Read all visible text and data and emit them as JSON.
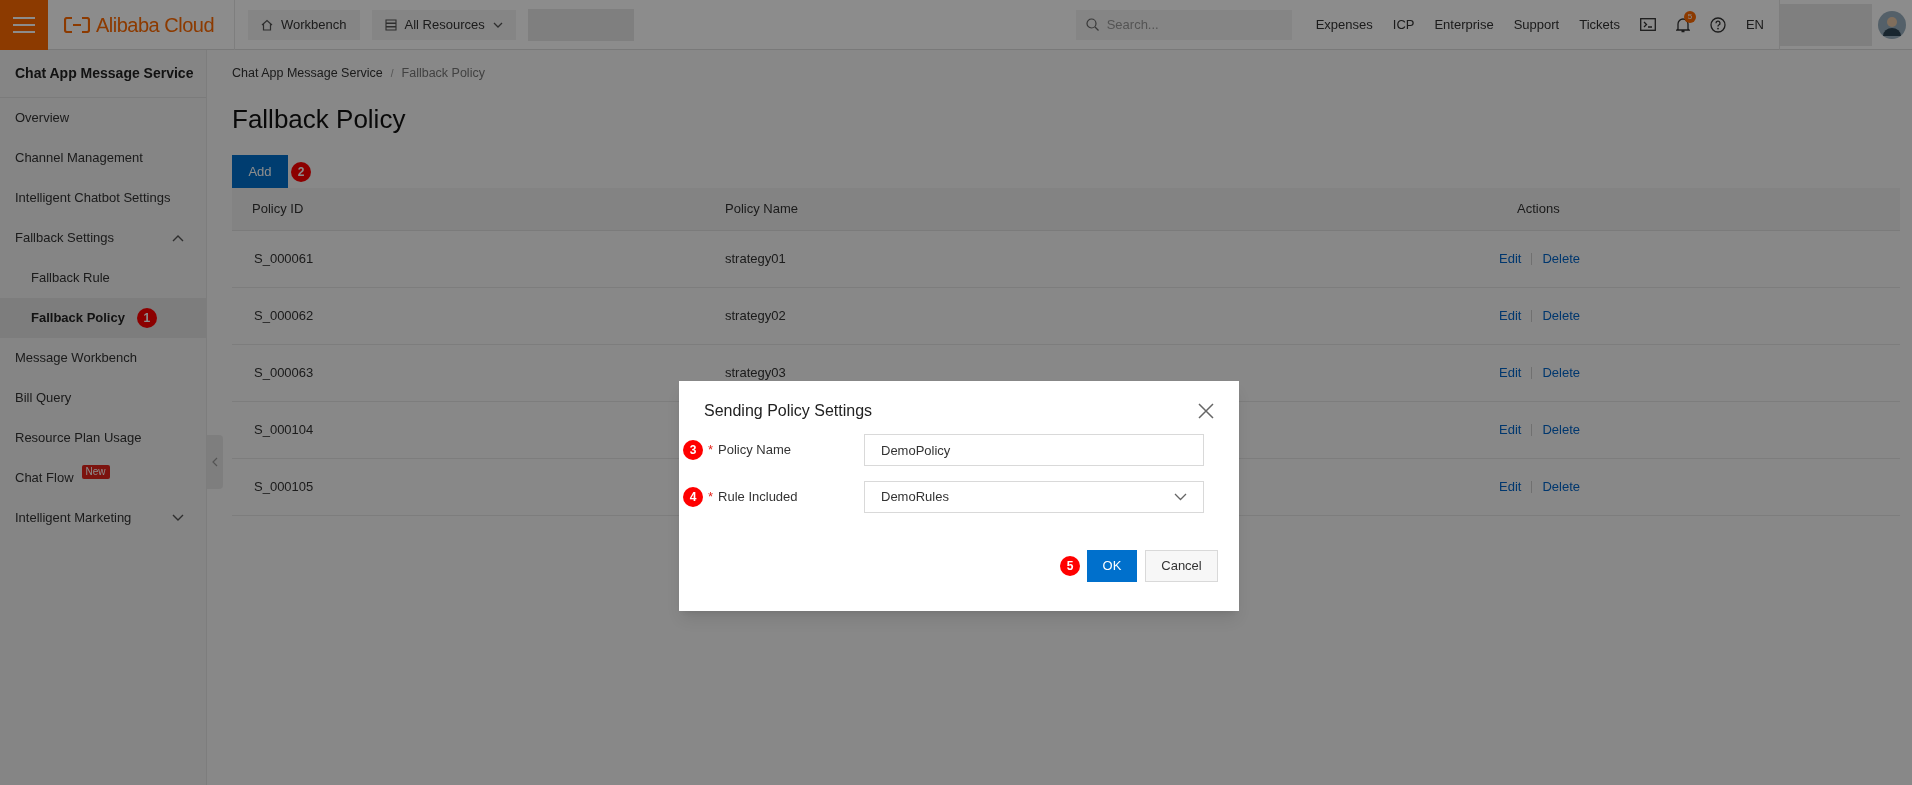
{
  "topbar": {
    "logo": "Alibaba Cloud",
    "workbench": "Workbench",
    "resources": "All Resources",
    "search": {
      "placeholder": "Search..."
    },
    "links": [
      "Expenses",
      "ICP",
      "Enterprise",
      "Support",
      "Tickets"
    ],
    "notification_count": "5",
    "language": "EN"
  },
  "sidebar": {
    "title": "Chat App Message Service",
    "items": [
      {
        "label": "Overview",
        "selected": false
      },
      {
        "label": "Channel Management",
        "selected": false
      },
      {
        "label": "Intelligent Chatbot Settings",
        "selected": false
      },
      {
        "label": "Fallback Settings",
        "selected": false,
        "expanded": true,
        "children": [
          {
            "label": "Fallback Rule",
            "selected": false
          },
          {
            "label": "Fallback Policy",
            "selected": true,
            "marker": "1"
          }
        ]
      },
      {
        "label": "Message Workbench",
        "selected": false
      },
      {
        "label": "Bill Query",
        "selected": false
      },
      {
        "label": "Resource Plan Usage",
        "selected": false
      },
      {
        "label": "Chat Flow",
        "selected": false,
        "badge": "New"
      },
      {
        "label": "Intelligent Marketing",
        "selected": false,
        "expanded": false
      }
    ]
  },
  "breadcrumb": {
    "items": [
      "Chat App Message Service",
      "Fallback Policy"
    ],
    "separator": "/"
  },
  "page_title": "Fallback Policy",
  "add_button": {
    "label": "Add",
    "marker": "2"
  },
  "table": {
    "columns": [
      "Policy ID",
      "Policy Name",
      "Actions"
    ],
    "rows": [
      {
        "id": "S_000061",
        "name": "strategy01",
        "actions": [
          "Edit",
          "Delete"
        ]
      },
      {
        "id": "S_000062",
        "name": "strategy02",
        "actions": [
          "Edit",
          "Delete"
        ]
      },
      {
        "id": "S_000063",
        "name": "strategy03",
        "actions": [
          "Edit",
          "Delete"
        ]
      },
      {
        "id": "S_000104",
        "actions": [
          "Edit",
          "Delete"
        ]
      },
      {
        "id": "S_000105",
        "actions": [
          "Edit",
          "Delete"
        ]
      }
    ]
  },
  "dialog": {
    "title": "Sending Policy Settings",
    "fields": [
      {
        "kind": "input",
        "label": "Policy Name",
        "required_mark": "*",
        "value": "DemoPolicy",
        "marker": "3"
      },
      {
        "kind": "select",
        "label": "Rule Included",
        "required_mark": "*",
        "value": "DemoRules",
        "marker": "4"
      }
    ],
    "ok": {
      "label": "OK",
      "marker": "5"
    },
    "cancel": {
      "label": "Cancel"
    }
  }
}
